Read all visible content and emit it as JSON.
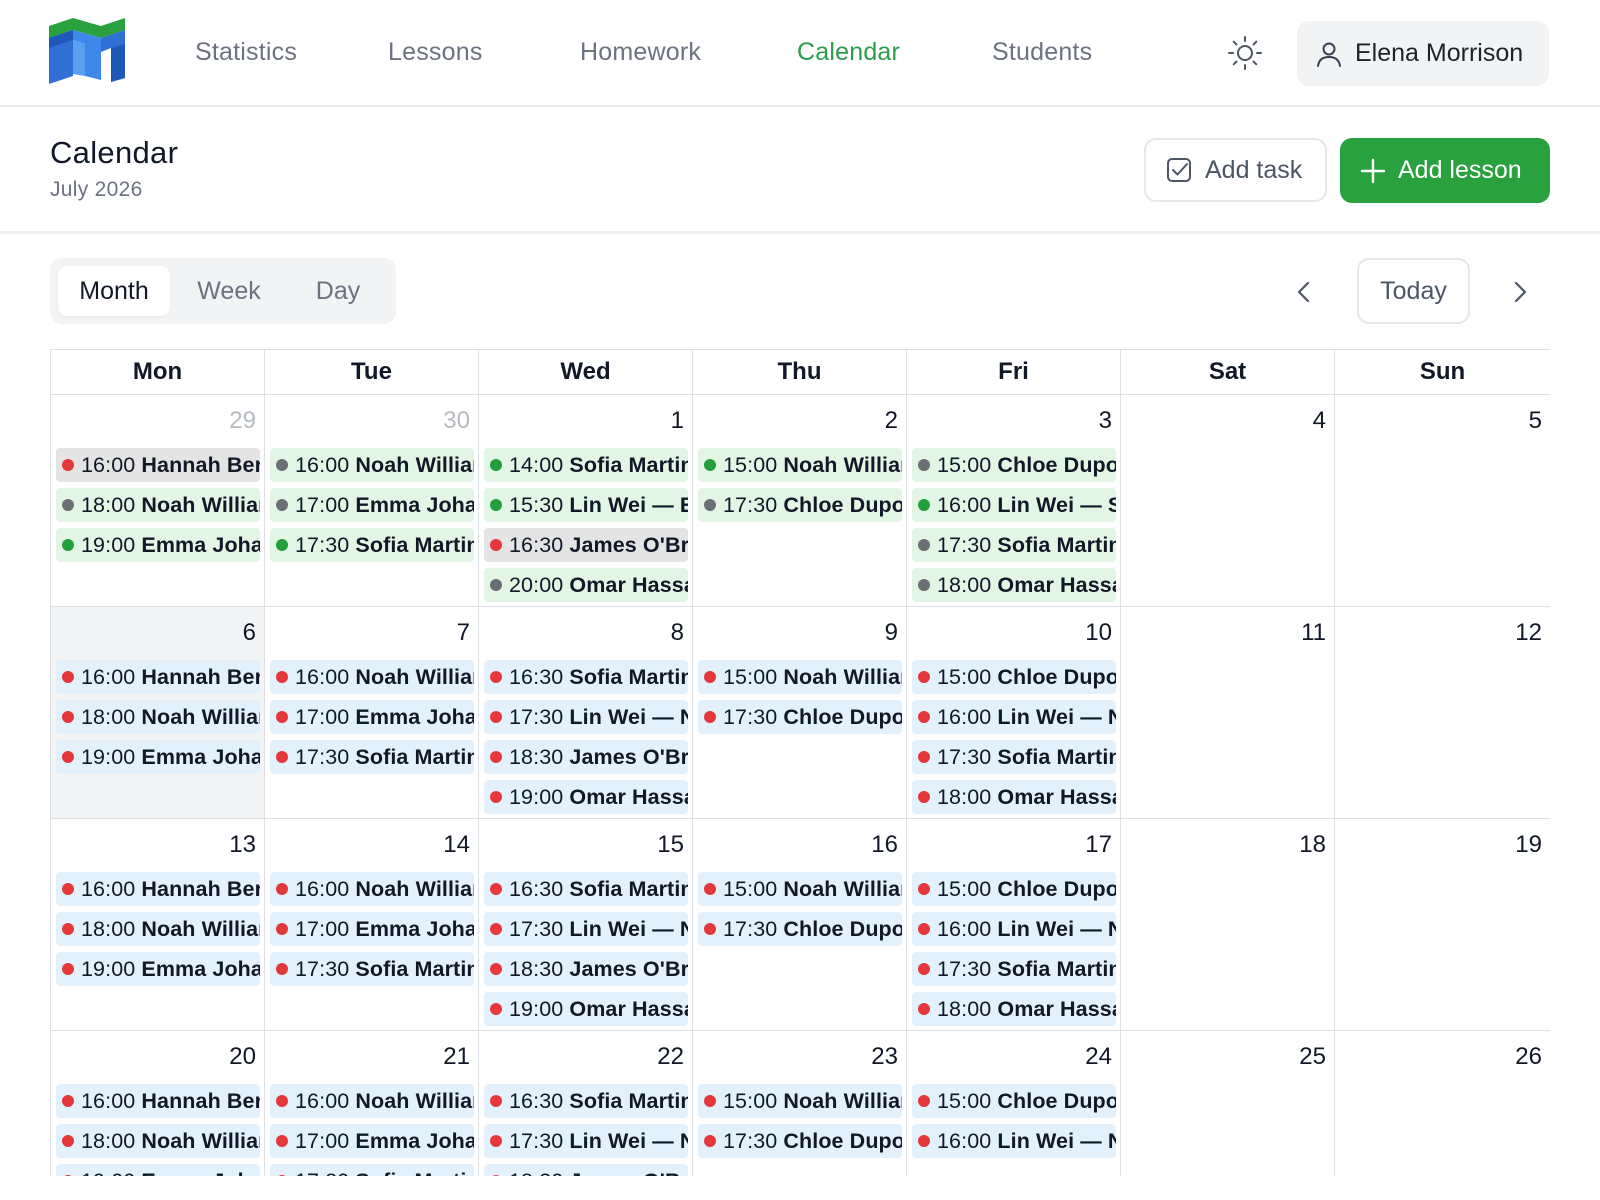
{
  "nav": {
    "items": [
      {
        "label": "Statistics",
        "active": false
      },
      {
        "label": "Lessons",
        "active": false
      },
      {
        "label": "Homework",
        "active": false
      },
      {
        "label": "Calendar",
        "active": true
      },
      {
        "label": "Students",
        "active": false
      }
    ],
    "theme_icon": "sun-icon",
    "user": {
      "name": "Elena Morrison",
      "icon": "user-icon"
    }
  },
  "page": {
    "title": "Calendar",
    "subtitle": "July 2026",
    "add_task_label": "Add task",
    "add_lesson_label": "Add lesson"
  },
  "toolbar": {
    "views": [
      "Month",
      "Week",
      "Day"
    ],
    "active_view": "Month",
    "today_label": "Today"
  },
  "colors": {
    "accent": "#2aa13f",
    "event_green_bg": "#e3f6e6",
    "event_blue_bg": "#e3f1fd",
    "event_grey_bg": "#e4e4e4",
    "status_green": "#23a03c",
    "status_red": "#e5383b",
    "status_grey": "#6b7075"
  },
  "calendar": {
    "weekdays": [
      "Mon",
      "Tue",
      "Wed",
      "Thu",
      "Fri",
      "Sat",
      "Sun"
    ],
    "weeks": [
      [
        {
          "day": "29",
          "muted": true,
          "events": [
            {
              "time": "16:00",
              "text": "Hannah Berg",
              "bg": "grey",
              "dot": "red"
            },
            {
              "time": "18:00",
              "text": "Noah Williams",
              "bg": "green",
              "dot": "grey"
            },
            {
              "time": "19:00",
              "text": "Emma Johansson",
              "bg": "green",
              "dot": "green"
            }
          ]
        },
        {
          "day": "30",
          "muted": true,
          "events": [
            {
              "time": "16:00",
              "text": "Noah Williams",
              "bg": "green",
              "dot": "grey"
            },
            {
              "time": "17:00",
              "text": "Emma Johansson",
              "bg": "green",
              "dot": "grey"
            },
            {
              "time": "17:30",
              "text": "Sofia Martinez",
              "bg": "green",
              "dot": "green"
            }
          ]
        },
        {
          "day": "1",
          "events": [
            {
              "time": "14:00",
              "text": "Sofia Martinez",
              "bg": "green",
              "dot": "green"
            },
            {
              "time": "15:30",
              "text": "Lin Wei — English",
              "bg": "green",
              "dot": "green"
            },
            {
              "time": "16:30",
              "text": "James O'Brien",
              "bg": "grey",
              "dot": "red"
            },
            {
              "time": "20:00",
              "text": "Omar Hassan",
              "bg": "green",
              "dot": "grey"
            }
          ]
        },
        {
          "day": "2",
          "events": [
            {
              "time": "15:00",
              "text": "Noah Williams",
              "bg": "green",
              "dot": "green"
            },
            {
              "time": "17:30",
              "text": "Chloe Dupont",
              "bg": "green",
              "dot": "grey"
            }
          ]
        },
        {
          "day": "3",
          "events": [
            {
              "time": "15:00",
              "text": "Chloe Dupont",
              "bg": "green",
              "dot": "grey"
            },
            {
              "time": "16:00",
              "text": "Lin Wei — Speaking",
              "bg": "green",
              "dot": "green"
            },
            {
              "time": "17:30",
              "text": "Sofia Martinez",
              "bg": "green",
              "dot": "grey"
            },
            {
              "time": "18:00",
              "text": "Omar Hassan",
              "bg": "green",
              "dot": "grey"
            }
          ]
        },
        {
          "day": "4",
          "events": []
        },
        {
          "day": "5",
          "events": []
        }
      ],
      [
        {
          "day": "6",
          "shade": true,
          "events": [
            {
              "time": "16:00",
              "text": "Hannah Berg",
              "bg": "blue",
              "dot": "red"
            },
            {
              "time": "18:00",
              "text": "Noah Williams",
              "bg": "blue",
              "dot": "red"
            },
            {
              "time": "19:00",
              "text": "Emma Johansson",
              "bg": "blue",
              "dot": "red"
            }
          ]
        },
        {
          "day": "7",
          "events": [
            {
              "time": "16:00",
              "text": "Noah Williams",
              "bg": "blue",
              "dot": "red"
            },
            {
              "time": "17:00",
              "text": "Emma Johansson",
              "bg": "blue",
              "dot": "red"
            },
            {
              "time": "17:30",
              "text": "Sofia Martinez",
              "bg": "blue",
              "dot": "red"
            }
          ]
        },
        {
          "day": "8",
          "events": [
            {
              "time": "16:30",
              "text": "Sofia Martinez",
              "bg": "blue",
              "dot": "red"
            },
            {
              "time": "17:30",
              "text": "Lin Wei — New",
              "bg": "blue",
              "dot": "red"
            },
            {
              "time": "18:30",
              "text": "James O'Brien",
              "bg": "blue",
              "dot": "red"
            },
            {
              "time": "19:00",
              "text": "Omar Hassan",
              "bg": "blue",
              "dot": "red"
            }
          ]
        },
        {
          "day": "9",
          "events": [
            {
              "time": "15:00",
              "text": "Noah Williams",
              "bg": "blue",
              "dot": "red"
            },
            {
              "time": "17:30",
              "text": "Chloe Dupont",
              "bg": "blue",
              "dot": "red"
            }
          ]
        },
        {
          "day": "10",
          "events": [
            {
              "time": "15:00",
              "text": "Chloe Dupont",
              "bg": "blue",
              "dot": "red"
            },
            {
              "time": "16:00",
              "text": "Lin Wei — New",
              "bg": "blue",
              "dot": "red"
            },
            {
              "time": "17:30",
              "text": "Sofia Martinez",
              "bg": "blue",
              "dot": "red"
            },
            {
              "time": "18:00",
              "text": "Omar Hassan",
              "bg": "blue",
              "dot": "red"
            }
          ]
        },
        {
          "day": "11",
          "events": []
        },
        {
          "day": "12",
          "events": []
        }
      ],
      [
        {
          "day": "13",
          "events": [
            {
              "time": "16:00",
              "text": "Hannah Berg",
              "bg": "blue",
              "dot": "red"
            },
            {
              "time": "18:00",
              "text": "Noah Williams",
              "bg": "blue",
              "dot": "red"
            },
            {
              "time": "19:00",
              "text": "Emma Johansson",
              "bg": "blue",
              "dot": "red"
            }
          ]
        },
        {
          "day": "14",
          "events": [
            {
              "time": "16:00",
              "text": "Noah Williams",
              "bg": "blue",
              "dot": "red"
            },
            {
              "time": "17:00",
              "text": "Emma Johansson",
              "bg": "blue",
              "dot": "red"
            },
            {
              "time": "17:30",
              "text": "Sofia Martinez",
              "bg": "blue",
              "dot": "red"
            }
          ]
        },
        {
          "day": "15",
          "events": [
            {
              "time": "16:30",
              "text": "Sofia Martinez",
              "bg": "blue",
              "dot": "red"
            },
            {
              "time": "17:30",
              "text": "Lin Wei — New",
              "bg": "blue",
              "dot": "red"
            },
            {
              "time": "18:30",
              "text": "James O'Brien",
              "bg": "blue",
              "dot": "red"
            },
            {
              "time": "19:00",
              "text": "Omar Hassan",
              "bg": "blue",
              "dot": "red"
            }
          ]
        },
        {
          "day": "16",
          "events": [
            {
              "time": "15:00",
              "text": "Noah Williams",
              "bg": "blue",
              "dot": "red"
            },
            {
              "time": "17:30",
              "text": "Chloe Dupont",
              "bg": "blue",
              "dot": "red"
            }
          ]
        },
        {
          "day": "17",
          "events": [
            {
              "time": "15:00",
              "text": "Chloe Dupont",
              "bg": "blue",
              "dot": "red"
            },
            {
              "time": "16:00",
              "text": "Lin Wei — New",
              "bg": "blue",
              "dot": "red"
            },
            {
              "time": "17:30",
              "text": "Sofia Martinez",
              "bg": "blue",
              "dot": "red"
            },
            {
              "time": "18:00",
              "text": "Omar Hassan",
              "bg": "blue",
              "dot": "red"
            }
          ]
        },
        {
          "day": "18",
          "events": []
        },
        {
          "day": "19",
          "events": []
        }
      ],
      [
        {
          "day": "20",
          "events": [
            {
              "time": "16:00",
              "text": "Hannah Berg",
              "bg": "blue",
              "dot": "red"
            },
            {
              "time": "18:00",
              "text": "Noah Williams",
              "bg": "blue",
              "dot": "red"
            },
            {
              "time": "19:00",
              "text": "Emma Johansson",
              "bg": "blue",
              "dot": "red"
            }
          ]
        },
        {
          "day": "21",
          "events": [
            {
              "time": "16:00",
              "text": "Noah Williams",
              "bg": "blue",
              "dot": "red"
            },
            {
              "time": "17:00",
              "text": "Emma Johansson",
              "bg": "blue",
              "dot": "red"
            },
            {
              "time": "17:30",
              "text": "Sofia Martinez",
              "bg": "blue",
              "dot": "red"
            }
          ]
        },
        {
          "day": "22",
          "events": [
            {
              "time": "16:30",
              "text": "Sofia Martinez",
              "bg": "blue",
              "dot": "red"
            },
            {
              "time": "17:30",
              "text": "Lin Wei — New",
              "bg": "blue",
              "dot": "red"
            },
            {
              "time": "18:30",
              "text": "James O'Brien",
              "bg": "blue",
              "dot": "red"
            }
          ]
        },
        {
          "day": "23",
          "events": [
            {
              "time": "15:00",
              "text": "Noah Williams",
              "bg": "blue",
              "dot": "red"
            },
            {
              "time": "17:30",
              "text": "Chloe Dupont",
              "bg": "blue",
              "dot": "red"
            }
          ]
        },
        {
          "day": "24",
          "events": [
            {
              "time": "15:00",
              "text": "Chloe Dupont",
              "bg": "blue",
              "dot": "red"
            },
            {
              "time": "16:00",
              "text": "Lin Wei — New",
              "bg": "blue",
              "dot": "red"
            }
          ]
        },
        {
          "day": "25",
          "events": []
        },
        {
          "day": "26",
          "events": []
        }
      ]
    ]
  }
}
